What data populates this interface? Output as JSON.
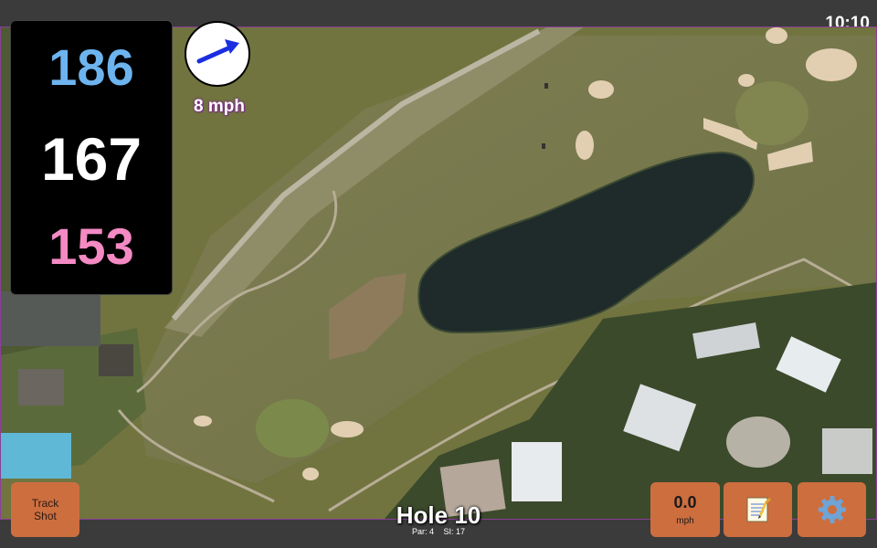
{
  "clock": "10:10",
  "yardages": {
    "back": "186",
    "middle": "167",
    "front": "153"
  },
  "yardage_colors": {
    "back": "#6db4ef",
    "middle": "#ffffff",
    "front": "#f48ac4"
  },
  "wind": {
    "speed": "8 mph",
    "arrow_icon": "wind-arrow-icon"
  },
  "buttons": {
    "track_shot_line1": "Track",
    "track_shot_line2": "Shot",
    "speed_value": "0.0",
    "speed_unit": "mph",
    "notes_icon": "notepad-icon",
    "settings_icon": "gear-icon"
  },
  "hole": {
    "title": "Hole 10",
    "par": "Par: 4",
    "si": "SI: 17"
  },
  "colors": {
    "accent_button": "#cd6e3f",
    "panel": "#000000",
    "bar": "#3b3b3b"
  }
}
